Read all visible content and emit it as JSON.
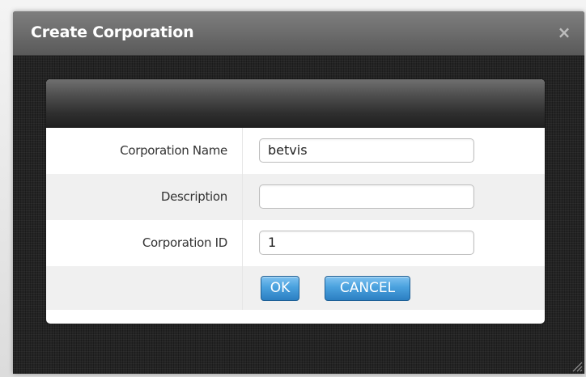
{
  "dialog": {
    "title": "Create Corporation",
    "close_icon": "×"
  },
  "form": {
    "rows": [
      {
        "label": "Corporation Name",
        "value": "betvis"
      },
      {
        "label": "Description",
        "value": ""
      },
      {
        "label": "Corporation ID",
        "value": "1"
      }
    ],
    "ok_label": "OK",
    "cancel_label": "CANCEL"
  },
  "colors": {
    "button_accent": "#2b7fc2",
    "title_bar": "#6c6c6c",
    "dialog_bg": "#242424"
  }
}
